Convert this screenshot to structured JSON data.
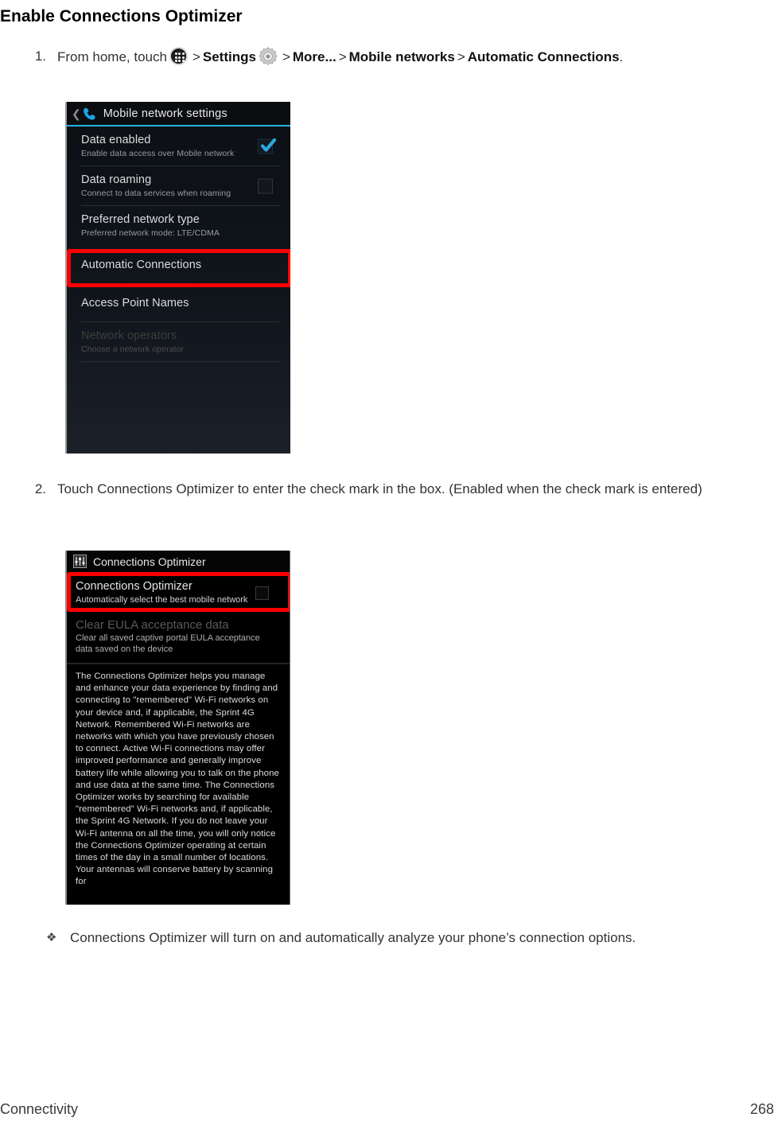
{
  "page": {
    "title": "Enable Connections Optimizer"
  },
  "steps": [
    {
      "number": "1.",
      "lead": "From home, touch",
      "apps_icon": "apps-grid-icon",
      "sep": ">",
      "settings_label": "Settings",
      "gear_icon": "gear-icon",
      "more_label": "More...",
      "mobile_networks_label": "Mobile networks",
      "automatic_connections_label": "Automatic Connections",
      "period": "."
    },
    {
      "number": "2.",
      "text": "Touch Connections Optimizer to enter the check mark in the box. (Enabled when the check mark is entered)"
    }
  ],
  "screenshot_mobile_network_settings": {
    "back_chevron": "back-chevron-icon",
    "header_icon": "phone-handset-icon",
    "header_title": "Mobile network settings",
    "rows": [
      {
        "title": "Data enabled",
        "subtitle": "Enable data access over Mobile network",
        "checkbox": "checked"
      },
      {
        "title": "Data roaming",
        "subtitle": "Connect to data services when roaming",
        "checkbox": "unchecked"
      },
      {
        "title": "Preferred network type",
        "subtitle": "Preferred network mode: LTE/CDMA",
        "checkbox": "none"
      },
      {
        "title": "Automatic Connections",
        "subtitle": "",
        "checkbox": "none",
        "highlighted": true
      },
      {
        "title": "Access Point Names",
        "subtitle": "",
        "checkbox": "none"
      },
      {
        "title": "Network operators",
        "subtitle": "Choose a network operator",
        "checkbox": "none",
        "disabled": true
      }
    ]
  },
  "screenshot_connections_optimizer": {
    "header_icon": "sliders-icon",
    "header_title": "Connections Optimizer",
    "rows": [
      {
        "title": "Connections Optimizer",
        "subtitle": "Automatically select the best mobile network",
        "checkbox": "unchecked",
        "highlighted": true
      },
      {
        "title": "Clear EULA acceptance data",
        "subtitle": "Clear all saved captive portal EULA acceptance data saved on the device",
        "checkbox": "none",
        "disabled": true
      }
    ],
    "description": "The Connections Optimizer helps you manage and enhance your data experience by finding and connecting to \"remembered\" Wi-Fi networks on your device and, if applicable, the Sprint 4G Network. Remembered Wi-Fi networks are networks with which you have previously chosen to connect. Active Wi-Fi connections may offer improved performance and generally improve battery life while allowing you to talk on the phone and use data at the same time. The Connections Optimizer works by searching for available \"remembered\" Wi-Fi networks and, if applicable, the Sprint 4G Network. If you do not leave your Wi-Fi antenna on all the time, you will only notice the Connections Optimizer operating at certain times of the day in a small number of locations. Your antennas will conserve battery by scanning for"
  },
  "note": {
    "bullet": "❖",
    "text": "Connections Optimizer will turn on and automatically analyze your phone’s connection options."
  },
  "footer": {
    "section": "Connectivity",
    "page_number": "268"
  },
  "colors": {
    "highlight_red": "#fe0000",
    "accent_blue": "#1fb6e0",
    "screen_background": "#000000"
  }
}
